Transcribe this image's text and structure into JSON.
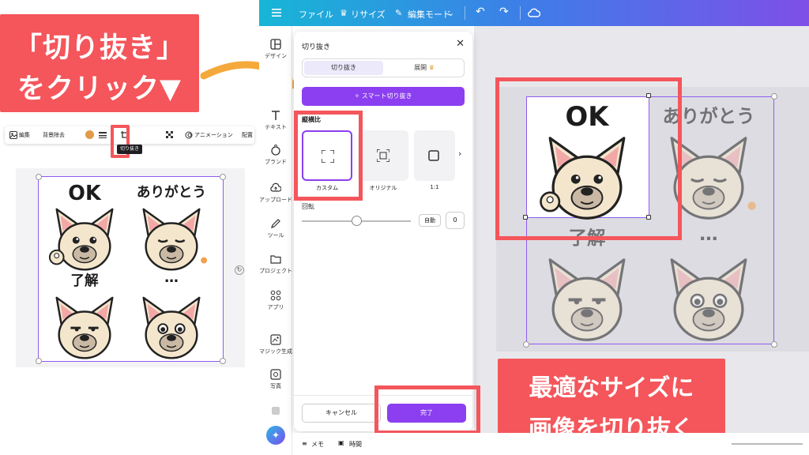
{
  "callout_left": {
    "line1": "「切り抜き」",
    "line2": "をクリック▼"
  },
  "callout_right": {
    "line1": "最適なサイズに",
    "line2": "画像を切り抜く"
  },
  "mini_toolbar": {
    "edit": "編集",
    "bg_remove": "背景除去",
    "animation": "アニメーション",
    "position": "配置",
    "tooltip": "切り抜き",
    "color": "#e09a4a"
  },
  "topbar": {
    "file": "ファイル",
    "resize": "リサイズ",
    "mode": "編集モード"
  },
  "rail": {
    "items": [
      "デザイン",
      "テキスト",
      "ブランド",
      "アップロード",
      "ツール",
      "プロジェクト",
      "アプリ",
      "マジック生成",
      "写真"
    ]
  },
  "panel": {
    "title": "切り抜き",
    "tab_crop": "切り抜き",
    "tab_expand": "展開",
    "smart_crop": "スマート切り抜き",
    "ratio_label": "縦横比",
    "ratio_options": [
      "カスタム",
      "オリジナル",
      "1:1"
    ],
    "rotation_label": "回転",
    "auto": "自動",
    "rotation_value": "0",
    "rotation_fraction": 0.5,
    "cancel": "キャンセル",
    "done": "完了"
  },
  "bottombar": {
    "memo": "メモ",
    "time": "時間"
  },
  "stickers": {
    "ok": "OK",
    "thanks": "ありがとう",
    "understood": "了解",
    "ellipsis": "…"
  },
  "colors": {
    "accent": "#8b3ff0",
    "callout": "#f4565b",
    "dog_body": "#f3e6cc",
    "dog_ear": "#f3a8a8"
  }
}
